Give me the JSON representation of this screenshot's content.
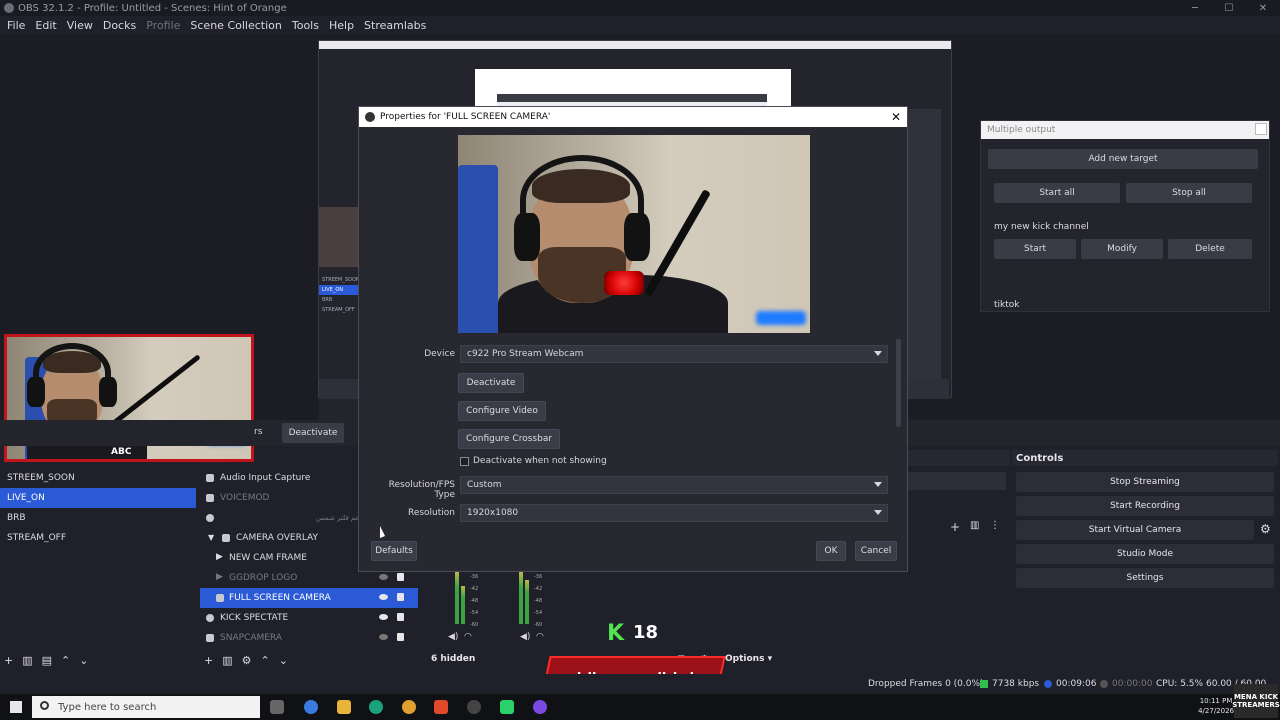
{
  "window": {
    "title": "OBS 32.1.2 - Profile: Untitled - Scenes: Hint of Orange"
  },
  "menu": [
    "File",
    "Edit",
    "View",
    "Docks",
    "Profile",
    "Scene Collection",
    "Tools",
    "Help",
    "Streamlabs"
  ],
  "dialog": {
    "title": "Properties for 'FULL SCREEN CAMERA'",
    "device_label": "Device",
    "device_value": "c922 Pro Stream Webcam",
    "deactivate": "Deactivate",
    "configure_video": "Configure Video",
    "configure_crossbar": "Configure Crossbar",
    "deactivate_when_not_showing": "Deactivate when not showing",
    "resfps_label": "Resolution/FPS Type",
    "resfps_value": "Custom",
    "resolution_label": "Resolution",
    "resolution_value": "1920x1080",
    "defaults": "Defaults",
    "ok": "OK",
    "cancel": "Cancel"
  },
  "multi_output": {
    "title": "Multiple output",
    "add_target": "Add new target",
    "start_all": "Start all",
    "stop_all": "Stop all",
    "channel_name": "my new kick channel",
    "start": "Start",
    "modify": "Modify",
    "delete": "Delete",
    "second_target": "tiktok"
  },
  "dock_bar": {
    "deactivate": "Deactivate",
    "truncated": "rs"
  },
  "webcam_overlay_label": "ABC",
  "scenes": [
    "STREEM_SOON",
    "LIVE_ON",
    "BRB",
    "STREAM_OFF"
  ],
  "sources": [
    {
      "name": "Audio Input Capture",
      "icon": "mic-icon",
      "dim": false
    },
    {
      "name": "VOICEMOD",
      "icon": "mic-icon",
      "dim": true
    },
    {
      "name": "رابط دعم فلتر شمس",
      "icon": "globe-icon",
      "dim": true
    },
    {
      "name": "CAMERA OVERLAY",
      "icon": "folder-icon",
      "dim": false
    },
    {
      "name": "NEW CAM FRAME",
      "icon": "play-icon",
      "dim": false
    },
    {
      "name": "GGDROP LOGO",
      "icon": "play-icon",
      "dim": true
    },
    {
      "name": "FULL SCREEN CAMERA",
      "icon": "camera-icon",
      "dim": false
    },
    {
      "name": "KICK SPECTATE",
      "icon": "globe-icon",
      "dim": false
    },
    {
      "name": "SNAPCAMERA",
      "icon": "camera-icon",
      "dim": true
    }
  ],
  "mixer": {
    "hidden": "6 hidden",
    "options": "Options",
    "ticks": [
      "-36",
      "-42",
      "-48",
      "-54",
      "-60"
    ]
  },
  "controls": {
    "title": "Controls",
    "buttons": [
      "Stop Streaming",
      "Start Recording",
      "Start Virtual Camera",
      "Studio Mode",
      "Settings"
    ]
  },
  "status": {
    "dropped": "Dropped Frames 0 (0.0%)",
    "kbps": "7738 kbps",
    "stream_time": "00:09:06",
    "rec_time": "00:00:00",
    "cpu": "CPU: 5.5%",
    "fps": "60.00 / 60.00"
  },
  "taskbar": {
    "search_placeholder": "Type here to search",
    "time": "10:11 PM",
    "date": "4/27/2026"
  },
  "overlays": {
    "banner": "رابط الدونيشن بالبايو",
    "kick_num": "18",
    "badge": "MENA KICK STREAMERS"
  },
  "nested_scene_items": [
    "STREEM_SOON",
    "LIVE_ON",
    "BRB",
    "STREAM_OFF"
  ]
}
